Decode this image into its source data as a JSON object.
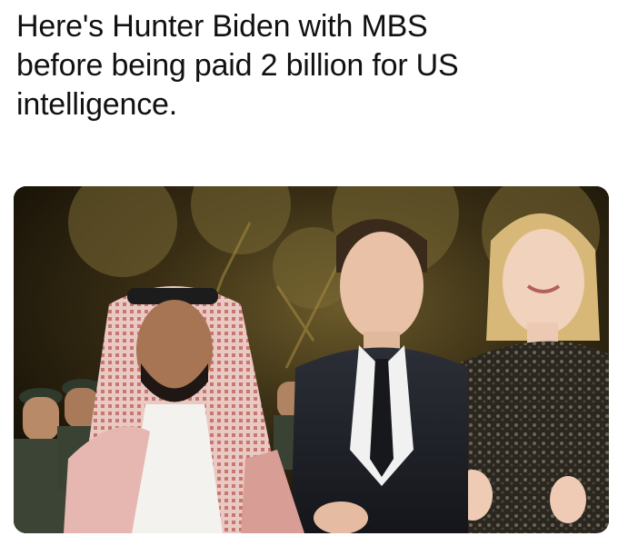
{
  "post": {
    "caption": "Here's Hunter Biden with MBS\nbefore being paid 2 billion for US\nintelligence."
  },
  "image": {
    "subject": "photograph"
  }
}
